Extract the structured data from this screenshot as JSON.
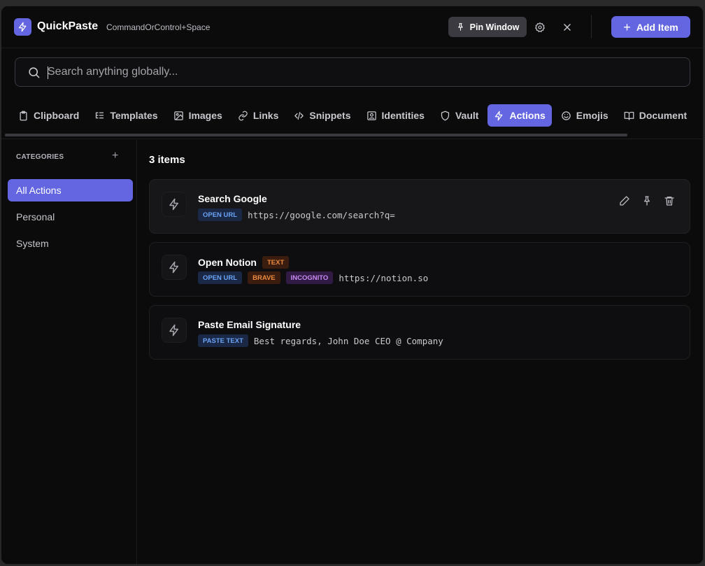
{
  "app": {
    "title": "QuickPaste",
    "shortcut": "CommandOrControl+Space",
    "pin_label": "Pin Window",
    "add_label": "Add Item",
    "accent": "#6366e0"
  },
  "search": {
    "placeholder": "Search anything globally...",
    "value": ""
  },
  "tabs": [
    {
      "label": "Clipboard",
      "icon": "clipboard-icon"
    },
    {
      "label": "Templates",
      "icon": "list-tree-icon"
    },
    {
      "label": "Images",
      "icon": "image-icon"
    },
    {
      "label": "Links",
      "icon": "link-icon"
    },
    {
      "label": "Snippets",
      "icon": "code-icon"
    },
    {
      "label": "Identities",
      "icon": "id-card-icon"
    },
    {
      "label": "Vault",
      "icon": "shield-icon"
    },
    {
      "label": "Actions",
      "icon": "bolt-icon",
      "active": true
    },
    {
      "label": "Emojis",
      "icon": "smile-icon"
    },
    {
      "label": "Document",
      "icon": "book-icon"
    }
  ],
  "sidebar": {
    "heading": "CATEGORIES",
    "add_symbol": "+",
    "items": [
      {
        "label": "All Actions",
        "active": true
      },
      {
        "label": "Personal"
      },
      {
        "label": "System"
      }
    ]
  },
  "main": {
    "count_label": "3 items",
    "items": [
      {
        "title": "Search Google",
        "title_badge": "",
        "badges": [
          "OPEN URL"
        ],
        "value": "https://google.com/search?q="
      },
      {
        "title": "Open Notion",
        "title_badge": "TEXT",
        "badges": [
          "OPEN URL",
          "BRAVE",
          "INCOGNITO"
        ],
        "value": "https://notion.so"
      },
      {
        "title": "Paste Email Signature",
        "title_badge": "",
        "badges": [
          "PASTE TEXT"
        ],
        "value": "Best regards, John Doe CEO @ Company"
      }
    ]
  }
}
